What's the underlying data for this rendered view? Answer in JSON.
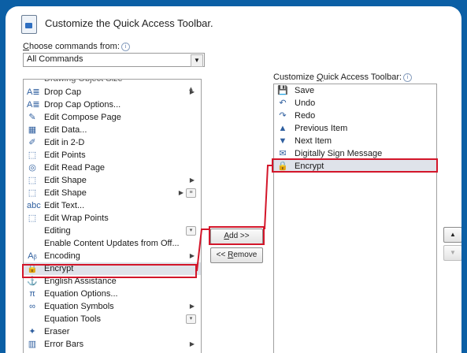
{
  "dialog": {
    "title": "Customize the Quick Access Toolbar.",
    "choose_label_prefix": "C",
    "choose_label_rest": "hoose commands from:",
    "choose_value": "All Commands",
    "qat_label_prefix": "Customize ",
    "qat_label_underlined": "Q",
    "qat_label_rest": "uick Access Toolbar:"
  },
  "left_list": {
    "items": [
      {
        "label": "Drop Cap",
        "icon": "drop-cap-icon",
        "glyph": "A≣",
        "submenu": true
      },
      {
        "label": "Drop Cap Options...",
        "icon": "drop-cap-options-icon",
        "glyph": "A≣"
      },
      {
        "label": "Edit Compose Page",
        "icon": "edit-compose-page-icon",
        "glyph": "✎"
      },
      {
        "label": "Edit Data...",
        "icon": "edit-data-icon",
        "glyph": "▦"
      },
      {
        "label": "Edit in 2-D",
        "icon": "edit-2d-icon",
        "glyph": "✐"
      },
      {
        "label": "Edit Points",
        "icon": "edit-points-icon",
        "glyph": "⬚"
      },
      {
        "label": "Edit Read Page",
        "icon": "edit-read-page-icon",
        "glyph": "◎"
      },
      {
        "label": "Edit Shape",
        "icon": "edit-shape-icon",
        "glyph": "⬚",
        "submenu": true
      },
      {
        "label": "Edit Shape",
        "icon": "edit-shape-icon",
        "glyph": "⬚",
        "submenu": true,
        "mini": "≡"
      },
      {
        "label": "Edit Text...",
        "icon": "edit-text-icon",
        "glyph": "abc"
      },
      {
        "label": "Edit Wrap Points",
        "icon": "edit-wrap-points-icon",
        "glyph": "⬚"
      },
      {
        "label": "Editing",
        "icon": "",
        "glyph": "",
        "mini": "▾"
      },
      {
        "label": "Enable Content Updates from Off...",
        "icon": "",
        "glyph": ""
      },
      {
        "label": "Encoding",
        "icon": "encoding-icon",
        "glyph": "Aᵦ",
        "submenu": true
      },
      {
        "label": "Encrypt",
        "icon": "encrypt-icon",
        "glyph": "🔒",
        "selected": true
      },
      {
        "label": "English Assistance",
        "icon": "english-assistance-icon",
        "glyph": "⚓"
      },
      {
        "label": "Equation Options...",
        "icon": "equation-options-icon",
        "glyph": "π"
      },
      {
        "label": "Equation Symbols",
        "icon": "equation-symbols-icon",
        "glyph": "∞",
        "submenu": true
      },
      {
        "label": "Equation Tools",
        "icon": "",
        "glyph": "",
        "mini": "▾"
      },
      {
        "label": "Eraser",
        "icon": "eraser-icon",
        "glyph": "✦"
      },
      {
        "label": "Error Bars",
        "icon": "error-bars-icon",
        "glyph": "▥",
        "submenu": true
      }
    ]
  },
  "right_list": {
    "items": [
      {
        "label": "Save",
        "icon": "save-icon",
        "glyph": "💾"
      },
      {
        "label": "Undo",
        "icon": "undo-icon",
        "glyph": "↶"
      },
      {
        "label": "Redo",
        "icon": "redo-icon",
        "glyph": "↷"
      },
      {
        "label": "Previous Item",
        "icon": "previous-item-icon",
        "glyph": "▲"
      },
      {
        "label": "Next Item",
        "icon": "next-item-icon",
        "glyph": "▼"
      },
      {
        "label": "Digitally Sign Message",
        "icon": "digitally-sign-icon",
        "glyph": "✉"
      },
      {
        "label": "Encrypt",
        "icon": "encrypt-icon",
        "glyph": "🔒",
        "selected": true
      }
    ]
  },
  "buttons": {
    "add_prefix": "",
    "add_underlined": "A",
    "add_rest": "dd >>",
    "remove_prefix": "<< ",
    "remove_underlined": "R",
    "remove_rest": "emove"
  },
  "colors": {
    "frame": "#0b5fa5",
    "highlight": "#d3162a",
    "selection": "#dfe3ea"
  }
}
